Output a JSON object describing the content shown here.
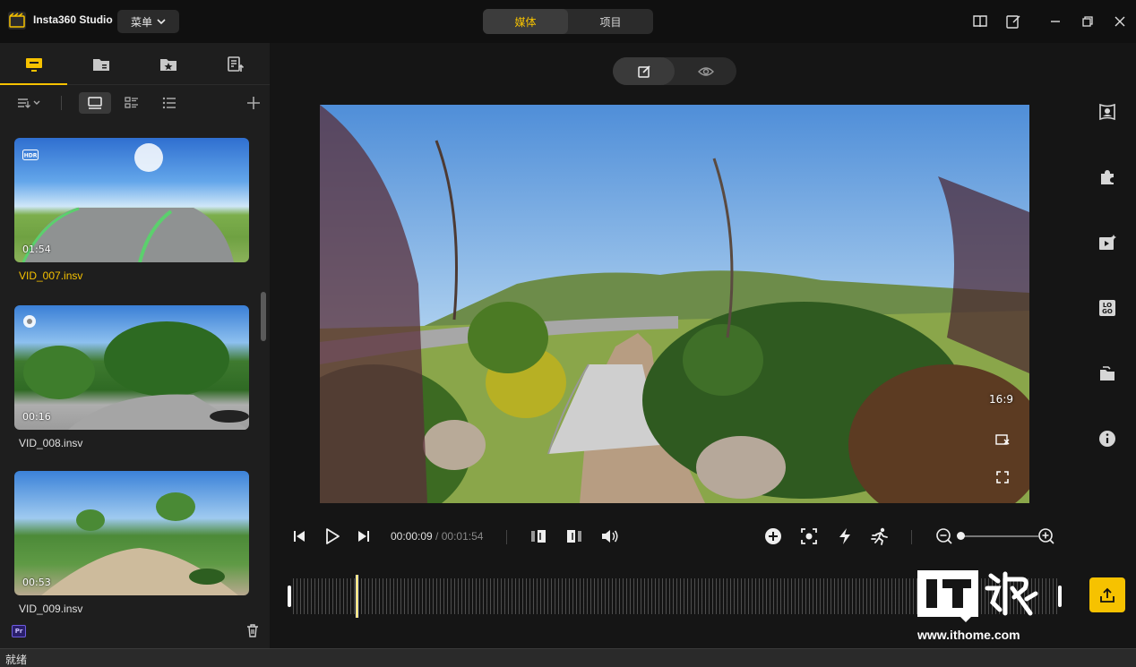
{
  "titlebar": {
    "app_name": "Insta360 Studio",
    "menu_label": "菜单",
    "tabs": [
      {
        "label": "媒体",
        "active": true
      },
      {
        "label": "项目",
        "active": false
      }
    ]
  },
  "sidebar": {
    "tab_icons": [
      "monitor-icon",
      "folder-icon",
      "star-folder-icon",
      "export-list-icon"
    ],
    "items": [
      {
        "duration": "01:54",
        "filename": "VID_007.insv",
        "selected": true,
        "badge": "HDR"
      },
      {
        "duration": "00:16",
        "filename": "VID_008.insv",
        "selected": false,
        "badge": "sun"
      },
      {
        "duration": "00:53",
        "filename": "VID_009.insv",
        "selected": false,
        "badge": ""
      }
    ],
    "pr_label": "Pr"
  },
  "preview": {
    "aspect_ratio": "16:9"
  },
  "playback": {
    "current_time": "00:00:09",
    "separator": " / ",
    "total_time": "00:01:54"
  },
  "status_bar": {
    "text": "就绪"
  },
  "watermark": {
    "url": "www.ithome.com"
  },
  "colors": {
    "accent": "#f6c200",
    "background": "#151515",
    "panel": "#1e1e1e"
  }
}
